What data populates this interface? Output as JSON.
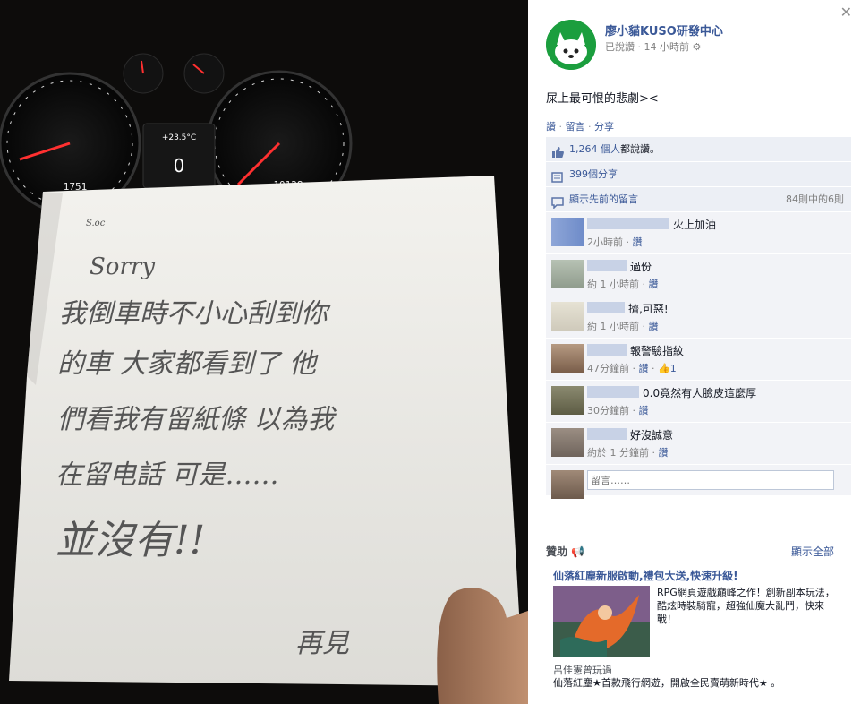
{
  "photo": {
    "temp_display": "+23.5°C",
    "odo_left": "1751",
    "odo_right": "10128",
    "note": {
      "line0": "S.oc",
      "line1": "Sorry",
      "line2": "我倒車時不小心刮到你",
      "line3": "的車 大家都看到了 他",
      "line4": "們看我有留紙條 以為我",
      "line5": "在留电話 可是……",
      "line6": "並沒有!!",
      "line7": "再見"
    }
  },
  "post": {
    "page_name": "廖小貓KUSO研發中心",
    "liked_label": "已說讚",
    "time": "14 小時前",
    "caption": "屎上最可恨的悲劇><",
    "actions": {
      "like": "讚",
      "comment": "留言",
      "share": "分享"
    },
    "likes_count": "1,264 個人",
    "likes_suffix": "都說讚。",
    "shares": "399個分享",
    "show_prev": "顯示先前的留言",
    "comment_count": "84則中的6則",
    "comments": [
      {
        "text": "火上加油",
        "time": "2小時前",
        "like": "讚",
        "likes": ""
      },
      {
        "text": "過份",
        "time": "約 1 小時前",
        "like": "讚",
        "likes": ""
      },
      {
        "text": "擠,可惡!",
        "time": "約 1 小時前",
        "like": "讚",
        "likes": ""
      },
      {
        "text": "報警驗指紋",
        "time": "47分鐘前",
        "like": "讚",
        "likes": "1"
      },
      {
        "text": "0.0竟然有人臉皮這麼厚",
        "time": "30分鐘前",
        "like": "讚",
        "likes": ""
      },
      {
        "text": "好沒誠意",
        "time": "約於 1 分鐘前",
        "like": "讚",
        "likes": ""
      }
    ],
    "comment_placeholder": "留言……"
  },
  "sponsored": {
    "title": "贊助",
    "see_all": "顯示全部",
    "ad_title": "仙落紅塵新服啟動,禮包大送,快速升級!",
    "ad_desc": "RPG網頁遊戲巔峰之作！創新副本玩法，酷炫時裝騎寵，超強仙魔大亂鬥，快來戰！",
    "ad_social": "呂佳憲曾玩過",
    "ad_foot": "仙落紅塵★首款飛行網遊，開啟全民賣萌新時代★ 。"
  }
}
